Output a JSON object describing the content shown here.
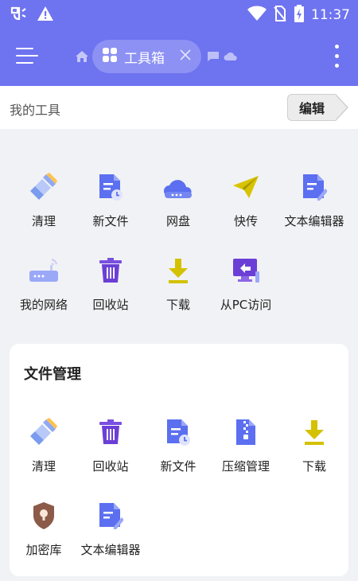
{
  "status_bar": {
    "time": "11:37",
    "icons": [
      "app-notification-icon",
      "warning-icon",
      "wifi-icon",
      "no-sim-icon",
      "battery-charging-icon"
    ]
  },
  "app_bar": {
    "menu_icon": "hamburger-menu-icon",
    "tabs": [
      {
        "icon": "home-icon"
      },
      {
        "icon": "toolbox-icon",
        "label": "工具箱",
        "active": true,
        "close_icon": "close-icon"
      },
      {
        "icon": "chat-icon"
      },
      {
        "icon": "cloud-icon"
      }
    ],
    "more_icon": "more-vertical-icon"
  },
  "my_tools": {
    "title": "我的工具",
    "edit_label": "编辑",
    "items": [
      {
        "label": "清理",
        "icon": "broom-icon"
      },
      {
        "label": "新文件",
        "icon": "new-file-icon"
      },
      {
        "label": "网盘",
        "icon": "cloud-drive-icon"
      },
      {
        "label": "快传",
        "icon": "paper-plane-icon"
      },
      {
        "label": "文本编辑器",
        "icon": "text-editor-icon"
      },
      {
        "label": "我的网络",
        "icon": "router-icon"
      },
      {
        "label": "回收站",
        "icon": "recycle-bin-icon"
      },
      {
        "label": "下载",
        "icon": "download-icon"
      },
      {
        "label": "从PC访问",
        "icon": "pc-access-icon"
      }
    ]
  },
  "file_management": {
    "title": "文件管理",
    "items": [
      {
        "label": "清理",
        "icon": "broom-icon"
      },
      {
        "label": "回收站",
        "icon": "recycle-bin-icon"
      },
      {
        "label": "新文件",
        "icon": "new-file-icon"
      },
      {
        "label": "压缩管理",
        "icon": "zip-archive-icon"
      },
      {
        "label": "下载",
        "icon": "download-icon"
      },
      {
        "label": "加密库",
        "icon": "shield-lock-icon"
      },
      {
        "label": "文本编辑器",
        "icon": "text-editor-icon"
      }
    ]
  },
  "colors": {
    "primary": "#6e73f0",
    "background": "#f1f2f5",
    "download_yellow": "#d4c100",
    "vault_brown": "#8b5a49"
  }
}
